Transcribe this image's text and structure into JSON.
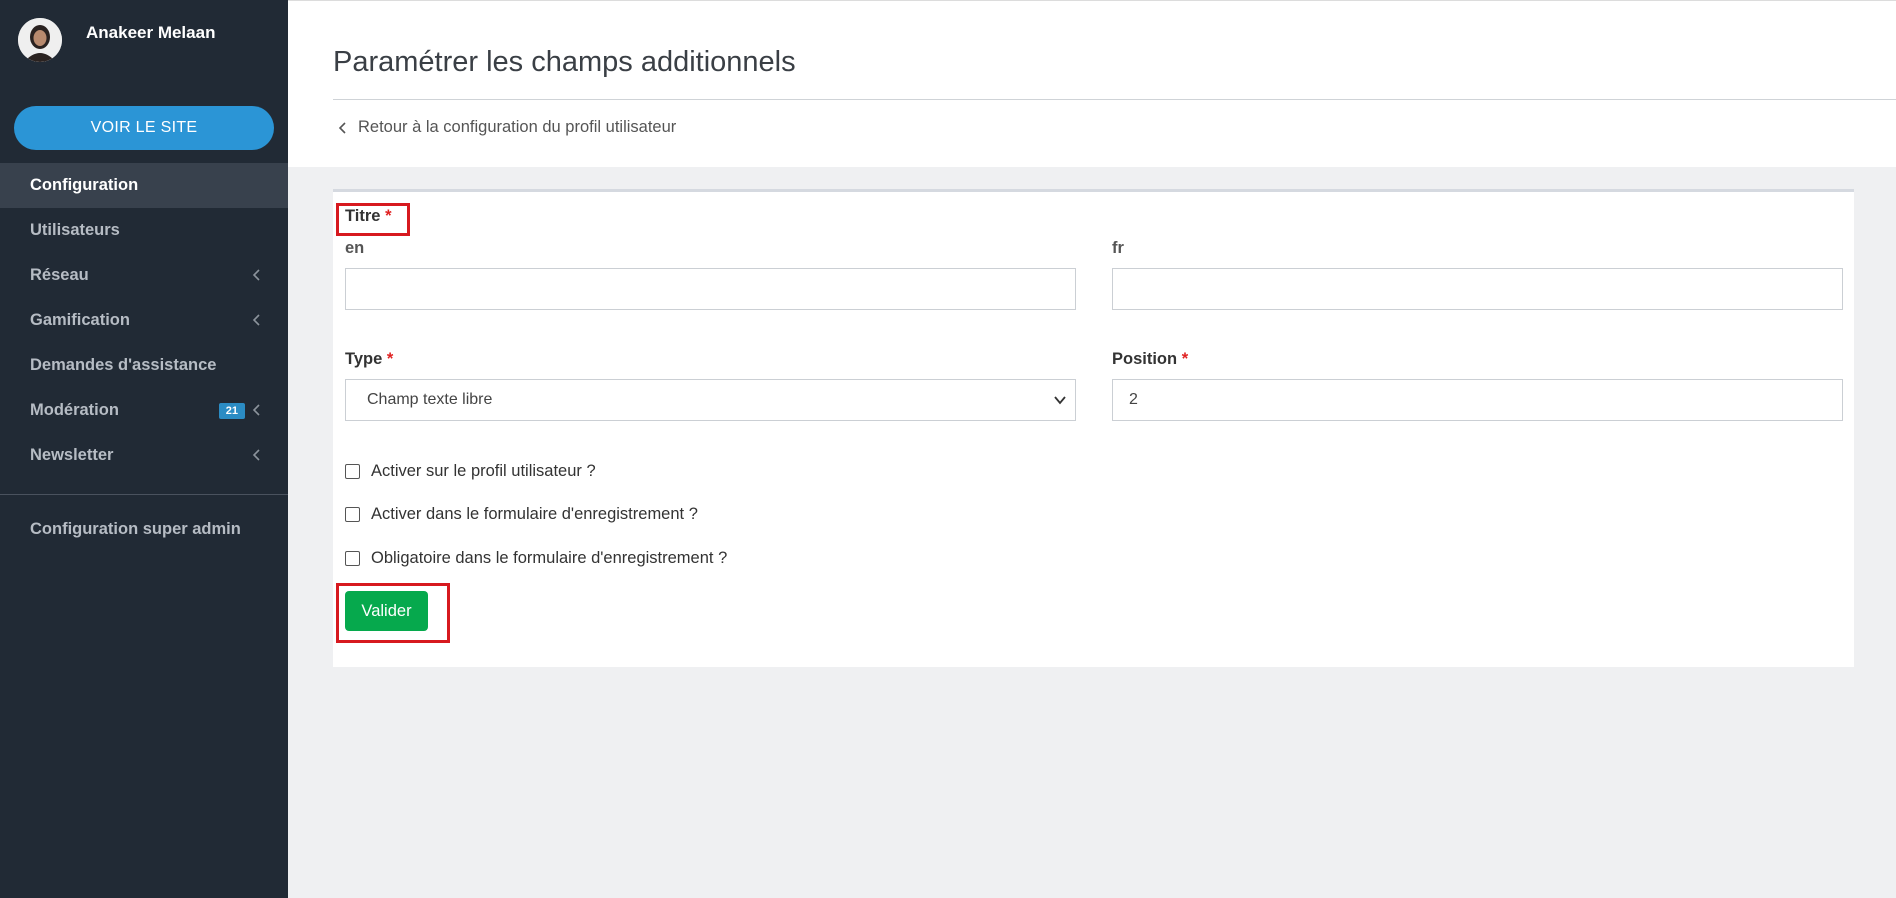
{
  "sidebar": {
    "username": "Anakeer Melaan",
    "site_button": "Voir le site",
    "items": [
      {
        "label": "Configuration",
        "active": true
      },
      {
        "label": "Utilisateurs"
      },
      {
        "label": "Réseau",
        "chevron": true
      },
      {
        "label": "Gamification",
        "chevron": true
      },
      {
        "label": "Demandes d'assistance"
      },
      {
        "label": "Modération",
        "badge": "21",
        "chevron": true
      },
      {
        "label": "Newsletter",
        "chevron": true
      }
    ],
    "super_admin": "Configuration super admin"
  },
  "header": {
    "title": "Paramétrer les champs additionnels",
    "back_link": "Retour à la configuration du profil utilisateur"
  },
  "form": {
    "titre_label": "Titre",
    "required_mark": "*",
    "lang_en": "en",
    "lang_fr": "fr",
    "titre_en_value": "",
    "titre_fr_value": "",
    "type_label": "Type",
    "type_value": "Champ texte libre",
    "position_label": "Position",
    "position_value": "2",
    "checkboxes": [
      {
        "label": "Activer sur le profil utilisateur ?",
        "checked": false
      },
      {
        "label": "Activer dans le formulaire d'enregistrement ?",
        "checked": false
      },
      {
        "label": "Obligatoire dans le formulaire d'enregistrement ?",
        "checked": false
      }
    ],
    "submit_label": "Valider"
  },
  "colors": {
    "sidebar_bg": "#212a35",
    "primary": "#2b95d6",
    "success": "#06a94d",
    "highlight": "#d7191f"
  }
}
